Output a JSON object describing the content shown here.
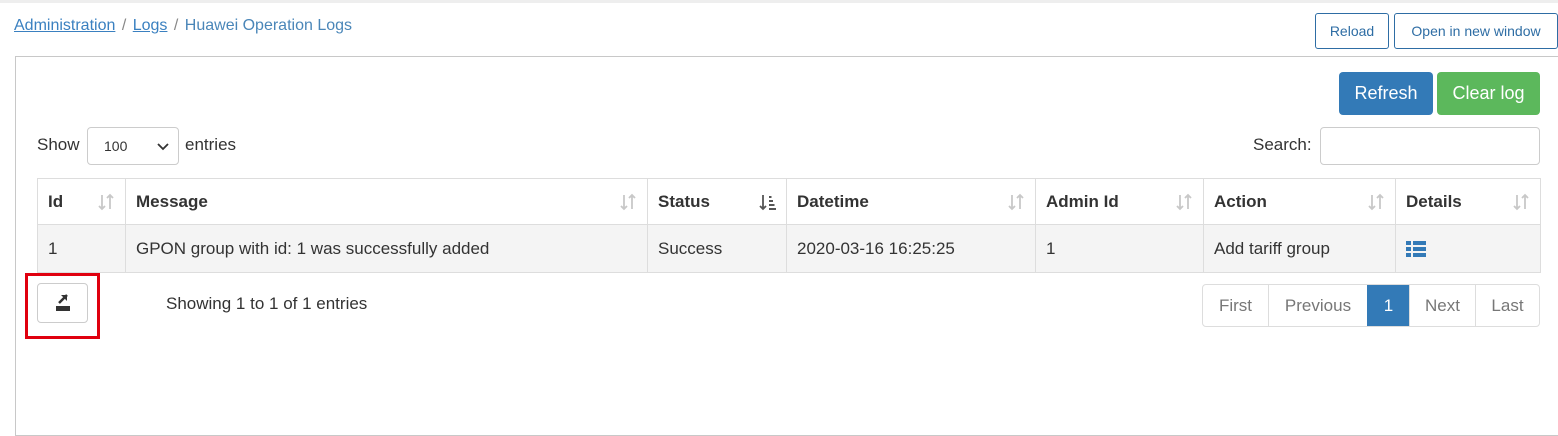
{
  "breadcrumb": {
    "items": [
      "Administration",
      "Logs"
    ],
    "separator": "/",
    "current": "Huawei Operation Logs"
  },
  "header": {
    "reload_label": "Reload",
    "open_new_window_label": "Open in new window"
  },
  "toolbar": {
    "refresh_label": "Refresh",
    "clear_log_label": "Clear log"
  },
  "length_menu": {
    "show_label": "Show",
    "entries_label": "entries",
    "selected": "100"
  },
  "search": {
    "label": "Search:",
    "value": ""
  },
  "table": {
    "columns": [
      "Id",
      "Message",
      "Status",
      "Datetime",
      "Admin Id",
      "Action",
      "Details"
    ],
    "rows": [
      [
        "1",
        "GPON group with id: 1 was successfully added",
        "Success",
        "2020-03-16 16:25:25",
        "1",
        "Add tariff group"
      ]
    ]
  },
  "info": "Showing 1 to 1 of 1 entries",
  "pagination": {
    "first": "First",
    "previous": "Previous",
    "current": "1",
    "next": "Next",
    "last": "Last"
  },
  "icons": {
    "details": "list-icon",
    "export": "export-icon",
    "sort_both": "sort-both-icon",
    "sort_desc": "sort-desc-icon"
  },
  "colors": {
    "primary": "#337ab7",
    "success": "#5cb85c",
    "link": "#3a80c0",
    "highlight": "#e0000f"
  }
}
